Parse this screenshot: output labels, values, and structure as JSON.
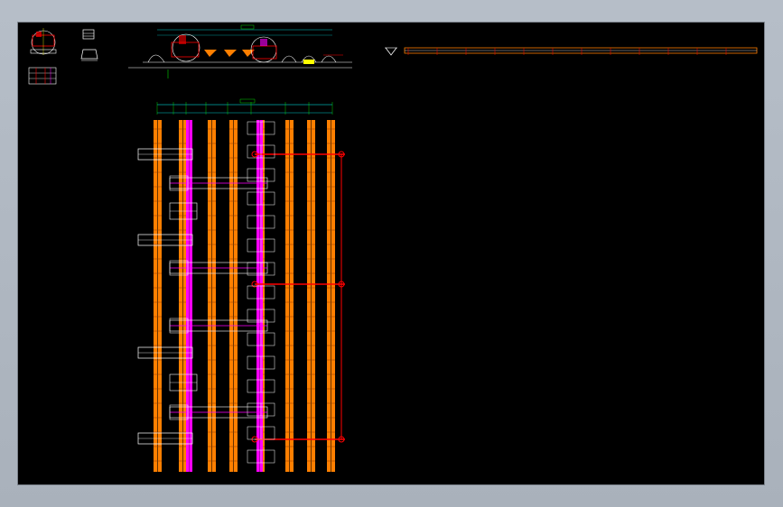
{
  "viewer": {
    "background": "#000000",
    "frame_color": "#b2bac4"
  },
  "colors": {
    "rail_orange": "#ff7f00",
    "rail_magenta": "#ff00ff",
    "annotation_red": "#ff0000",
    "line_white": "#ffffff",
    "dimension_green": "#00ff00",
    "dimension_cyan": "#00ffff",
    "accent_yellow": "#ffff00"
  },
  "plan_view": {
    "orange_rail_count": 9,
    "magenta_rail_count": 2,
    "cross_bracket_count": 4,
    "red_connector_count": 3
  }
}
